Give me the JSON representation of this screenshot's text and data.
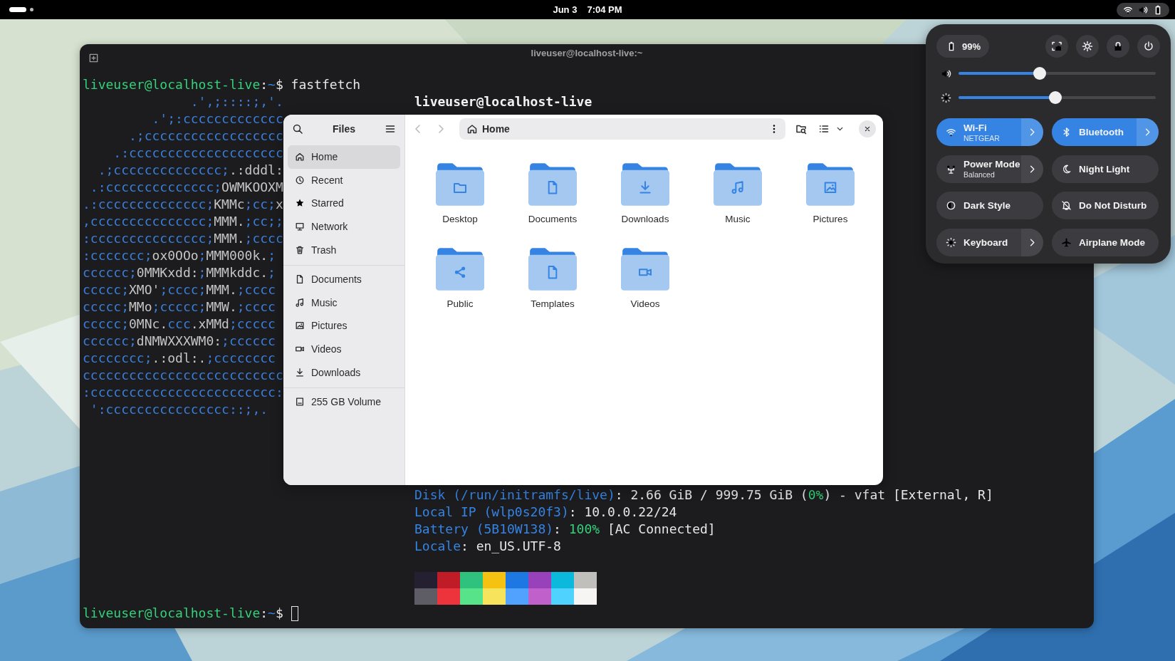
{
  "top_bar": {
    "date": "Jun 3",
    "time": "7:04 PM"
  },
  "terminal": {
    "title": "liveuser@localhost-live:~",
    "command_line": [
      {
        "text": "liveuser@localhost-live",
        "kind": "user"
      },
      {
        "text": ":",
        "kind": "plain"
      },
      {
        "text": "~",
        "kind": "path"
      },
      {
        "text": "$ fastfetch",
        "kind": "plain"
      }
    ],
    "logo": [
      [
        {
          "text": "              .',;::::;,'.",
          "kind": "logo"
        }
      ],
      [
        {
          "text": "         .';:ccccccccccccc",
          "kind": "logo"
        }
      ],
      [
        {
          "text": "      .;cccccccccccccccccc",
          "kind": "logo"
        }
      ],
      [
        {
          "text": "    .:cccccccccccccccccccc",
          "kind": "logo"
        }
      ],
      [
        {
          "text": "  .;cccccccccccccc;",
          "kind": "logo"
        },
        {
          "text": ".:dddl:",
          "kind": "mark"
        }
      ],
      [
        {
          "text": " .:cccccccccccccc;",
          "kind": "logo"
        },
        {
          "text": "OWMKOOXM",
          "kind": "mark"
        }
      ],
      [
        {
          "text": ".:cccccccccccccc;",
          "kind": "logo"
        },
        {
          "text": "KMMc",
          "kind": "mark"
        },
        {
          "text": ";cc;",
          "kind": "logo"
        },
        {
          "text": "x",
          "kind": "mark"
        }
      ],
      [
        {
          "text": ",ccccccccccccccc;",
          "kind": "logo"
        },
        {
          "text": "MMM.",
          "kind": "mark"
        },
        {
          "text": ";cc;;",
          "kind": "logo"
        }
      ],
      [
        {
          "text": ":ccccccccccccccc;",
          "kind": "logo"
        },
        {
          "text": "MMM.",
          "kind": "mark"
        },
        {
          "text": ";cccc",
          "kind": "logo"
        }
      ],
      [
        {
          "text": ":ccccccc;",
          "kind": "logo"
        },
        {
          "text": "ox0OOo",
          "kind": "mark"
        },
        {
          "text": ";",
          "kind": "logo"
        },
        {
          "text": "MMM000k.",
          "kind": "mark"
        },
        {
          "text": ";",
          "kind": "logo"
        }
      ],
      [
        {
          "text": "cccccc;",
          "kind": "logo"
        },
        {
          "text": "0MMKxdd:",
          "kind": "mark"
        },
        {
          "text": ";",
          "kind": "logo"
        },
        {
          "text": "MMMkddc.",
          "kind": "mark"
        },
        {
          "text": ";",
          "kind": "logo"
        }
      ],
      [
        {
          "text": "ccccc;",
          "kind": "logo"
        },
        {
          "text": "XMO'",
          "kind": "mark"
        },
        {
          "text": ";cccc;",
          "kind": "logo"
        },
        {
          "text": "MMM.",
          "kind": "mark"
        },
        {
          "text": ";cccc",
          "kind": "logo"
        }
      ],
      [
        {
          "text": "ccccc;",
          "kind": "logo"
        },
        {
          "text": "MMo",
          "kind": "mark"
        },
        {
          "text": ";ccccc;",
          "kind": "logo"
        },
        {
          "text": "MMW.",
          "kind": "mark"
        },
        {
          "text": ";cccc",
          "kind": "logo"
        }
      ],
      [
        {
          "text": "ccccc;",
          "kind": "logo"
        },
        {
          "text": "0MNc.",
          "kind": "mark"
        },
        {
          "text": "ccc",
          "kind": "logo"
        },
        {
          "text": ".xMMd",
          "kind": "mark"
        },
        {
          "text": ";ccccc",
          "kind": "logo"
        }
      ],
      [
        {
          "text": "cccccc;",
          "kind": "logo"
        },
        {
          "text": "dNMWXXXWM0:",
          "kind": "mark"
        },
        {
          "text": ";cccccc",
          "kind": "logo"
        }
      ],
      [
        {
          "text": "cccccccc;",
          "kind": "logo"
        },
        {
          "text": ".:odl:.",
          "kind": "mark"
        },
        {
          "text": ";cccccccc",
          "kind": "logo"
        }
      ],
      [
        {
          "text": "cccccccccccccccccccccccccc",
          "kind": "logo"
        }
      ],
      [
        {
          "text": ":cccccccccccccccccccccccc:",
          "kind": "logo"
        }
      ],
      [
        {
          "text": " ':cccccccccccccccc::;,.",
          "kind": "logo"
        }
      ]
    ],
    "host": "liveuser@localhost-live",
    "info": [
      [
        {
          "text": "Disk (/run/initramfs/live)",
          "kind": "key"
        },
        {
          "text": ": 2.66 GiB / 999.75 GiB (",
          "kind": "plain"
        },
        {
          "text": "0%",
          "kind": "good"
        },
        {
          "text": ") - vfat [External, R]",
          "kind": "plain"
        }
      ],
      [
        {
          "text": "Local IP (wlp0s20f3)",
          "kind": "key"
        },
        {
          "text": ": 10.0.0.22/24",
          "kind": "plain"
        }
      ],
      [
        {
          "text": "Battery (5B10W138)",
          "kind": "key"
        },
        {
          "text": ": ",
          "kind": "plain"
        },
        {
          "text": "100%",
          "kind": "good"
        },
        {
          "text": " [AC Connected]",
          "kind": "plain"
        }
      ],
      [
        {
          "text": "Locale",
          "kind": "key"
        },
        {
          "text": ": en_US.UTF-8",
          "kind": "plain"
        }
      ]
    ],
    "palette": [
      {
        "color": "#241f31"
      },
      {
        "color": "#c01c28"
      },
      {
        "color": "#2ec27e"
      },
      {
        "color": "#f5c211"
      },
      {
        "color": "#1e78e4"
      },
      {
        "color": "#9841bb"
      },
      {
        "color": "#0ab9dc"
      },
      {
        "color": "#c0bfbc"
      },
      {
        "color": "#5e5c64"
      },
      {
        "color": "#ed333b"
      },
      {
        "color": "#57e389"
      },
      {
        "color": "#f8e45c"
      },
      {
        "color": "#51a1ff"
      },
      {
        "color": "#c061cb"
      },
      {
        "color": "#4fd2fd"
      },
      {
        "color": "#f6f5f4"
      }
    ],
    "prompt": [
      {
        "text": "liveuser@localhost-live",
        "kind": "user"
      },
      {
        "text": ":",
        "kind": "plain"
      },
      {
        "text": "~",
        "kind": "path"
      },
      {
        "text": "$",
        "kind": "plain"
      }
    ]
  },
  "files": {
    "title": "Files",
    "location": "Home",
    "sidebar": [
      {
        "items": [
          {
            "label": "Home",
            "kind": "home",
            "selected": true
          },
          {
            "label": "Recent",
            "kind": "recent",
            "selected": false
          },
          {
            "label": "Starred",
            "kind": "starred",
            "selected": false
          },
          {
            "label": "Network",
            "kind": "network",
            "selected": false
          },
          {
            "label": "Trash",
            "kind": "trash",
            "selected": false
          }
        ]
      },
      {
        "items": [
          {
            "label": "Documents",
            "kind": "documents",
            "selected": false
          },
          {
            "label": "Music",
            "kind": "music",
            "selected": false
          },
          {
            "label": "Pictures",
            "kind": "pictures",
            "selected": false
          },
          {
            "label": "Videos",
            "kind": "videos",
            "selected": false
          },
          {
            "label": "Downloads",
            "kind": "downloads",
            "selected": false
          }
        ]
      },
      {
        "items": [
          {
            "label": "255 GB Volume",
            "kind": "volume",
            "selected": false
          }
        ]
      }
    ],
    "folders": [
      {
        "label": "Desktop",
        "kind": "desktop"
      },
      {
        "label": "Documents",
        "kind": "documents"
      },
      {
        "label": "Downloads",
        "kind": "downloads"
      },
      {
        "label": "Music",
        "kind": "music"
      },
      {
        "label": "Pictures",
        "kind": "pictures"
      },
      {
        "label": "Public",
        "kind": "public"
      },
      {
        "label": "Templates",
        "kind": "templates"
      },
      {
        "label": "Videos",
        "kind": "videos"
      }
    ]
  },
  "quick_settings": {
    "battery": "99%",
    "sliders": [
      {
        "kind": "volume",
        "level": 0.41
      },
      {
        "kind": "brightness",
        "level": 0.49
      }
    ],
    "toggles": [
      {
        "kind": "wifi",
        "title": "Wi-Fi",
        "subtitle": "NETGEAR",
        "on": true,
        "menu": true
      },
      {
        "kind": "bluetooth",
        "title": "Bluetooth",
        "on": true,
        "menu": true
      },
      {
        "kind": "power-mode",
        "title": "Power Mode",
        "subtitle": "Balanced",
        "on": false,
        "menu": true
      },
      {
        "kind": "night-light",
        "title": "Night Light",
        "on": false,
        "menu": false
      },
      {
        "kind": "dark-style",
        "title": "Dark Style",
        "on": false,
        "menu": false
      },
      {
        "kind": "do-not-disturb",
        "title": "Do Not Disturb",
        "on": false,
        "menu": false
      },
      {
        "kind": "keyboard",
        "title": "Keyboard",
        "on": false,
        "menu": true
      },
      {
        "kind": "airplane",
        "title": "Airplane Mode",
        "on": false,
        "menu": false
      }
    ]
  }
}
